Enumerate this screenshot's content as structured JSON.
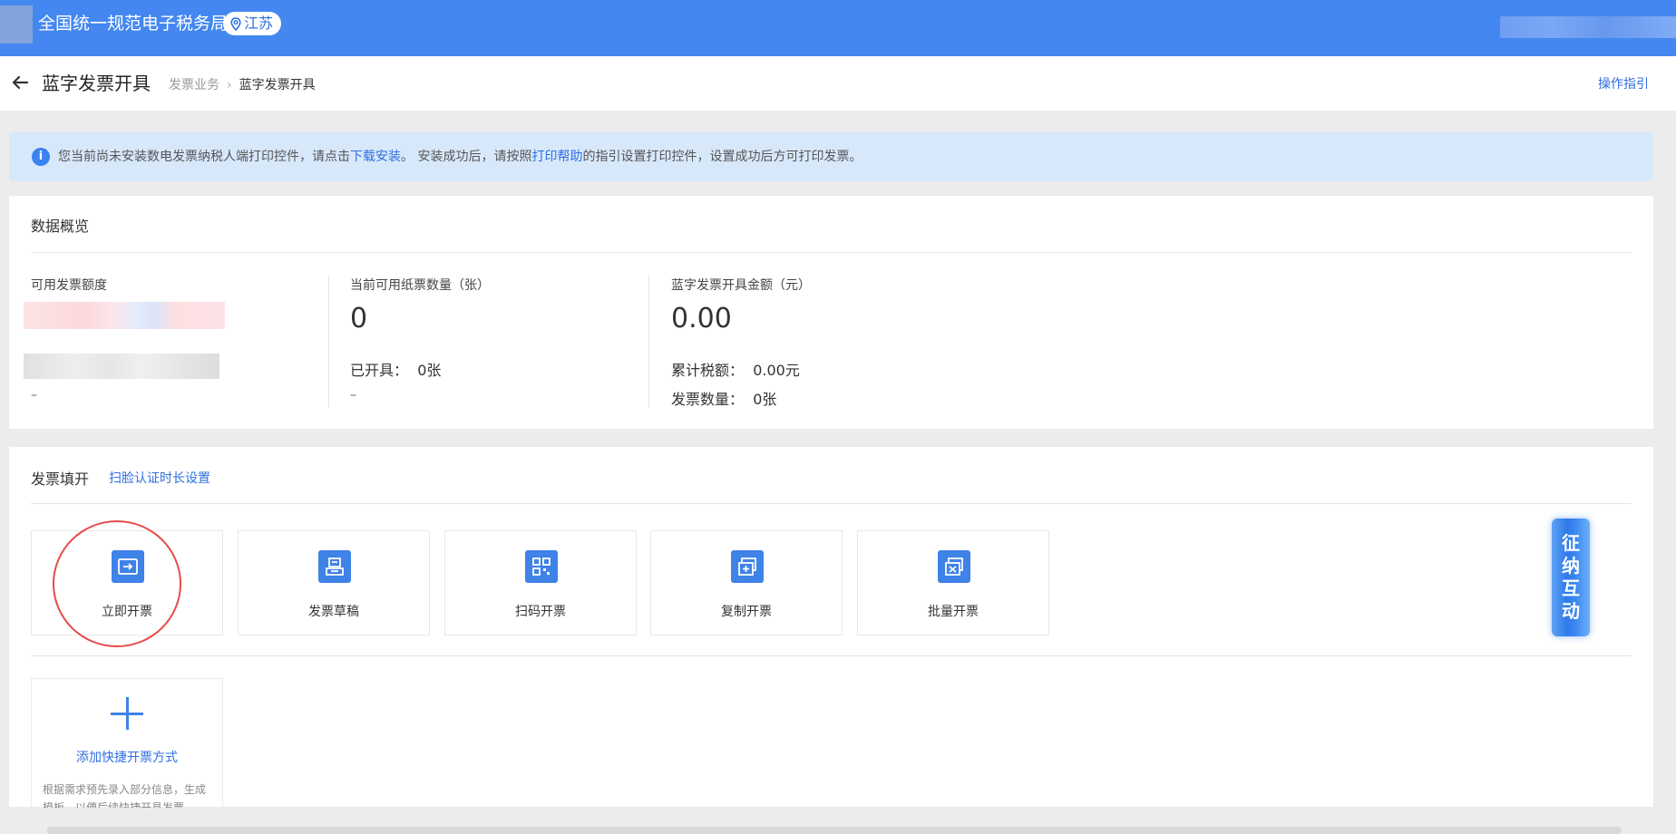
{
  "header": {
    "app_title": "全国统一规范电子税务局",
    "region": "江苏"
  },
  "page": {
    "title": "蓝字发票开具",
    "breadcrumb": [
      "发票业务",
      "蓝字发票开具"
    ],
    "guide_link": "操作指引"
  },
  "notice": {
    "text_before": "您当前尚未安装数电发票纳税人端打印控件，请点击",
    "download_link": "下载安装",
    "text_middle": "。 安装成功后，请按照",
    "help_link": "打印帮助",
    "text_after": "的指引设置打印控件，设置成功后方可打印发票。"
  },
  "overview": {
    "title": "数据概览",
    "quota_label": "可用发票额度",
    "quota_dash": "–",
    "paper": {
      "label": "当前可用纸票数量（张）",
      "value": "0",
      "issued_label": "已开具：",
      "issued_value": "0张",
      "dash": "–"
    },
    "blue": {
      "label": "蓝字发票开具金额（元）",
      "value": "0.00",
      "tax_label": "累计税额：",
      "tax_value": "0.00元",
      "count_label": "发票数量：",
      "count_value": "0张"
    }
  },
  "fill": {
    "title": "发票填开",
    "face_link": "扫脸认证时长设置",
    "tiles": [
      {
        "label": "立即开票",
        "icon": "issue-now-icon"
      },
      {
        "label": "发票草稿",
        "icon": "draft-icon"
      },
      {
        "label": "扫码开票",
        "icon": "qrcode-icon"
      },
      {
        "label": "复制开票",
        "icon": "copy-invoice-icon"
      },
      {
        "label": "批量开票",
        "icon": "batch-invoice-icon"
      }
    ],
    "add_quick": {
      "label": "添加快捷开票方式",
      "desc": "根据需求预先录入部分信息，生成模板，以便后续快捷开具发票"
    }
  },
  "float_button": {
    "text": "征纳互动"
  },
  "colors": {
    "brand": "#4487f0",
    "link": "#2f6fe0",
    "highlight_circle": "#e84a4a"
  }
}
